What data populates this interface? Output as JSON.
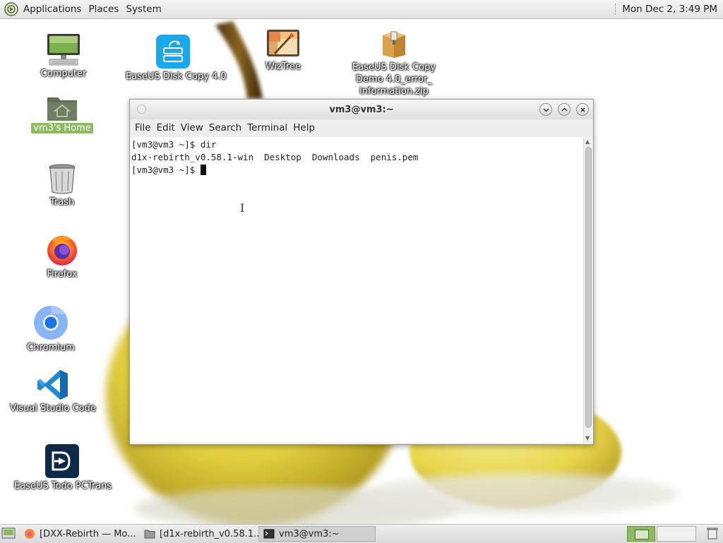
{
  "top_panel": {
    "menus": [
      "Applications",
      "Places",
      "System"
    ],
    "clock": "Mon Dec 2,  3:49 PM"
  },
  "desktop": {
    "icons": [
      {
        "label": "Computer",
        "icon": "computer-icon"
      },
      {
        "label": "vm3's Home",
        "icon": "home-folder-icon",
        "selected": true
      },
      {
        "label": "Trash",
        "icon": "trash-icon"
      },
      {
        "label": "Firefox",
        "icon": "firefox-icon"
      },
      {
        "label": "Chromium",
        "icon": "chromium-icon"
      },
      {
        "label": "Visual Studio Code",
        "icon": "vscode-icon"
      },
      {
        "label": "EaseUS Todo PCTrans",
        "icon": "easeus-pctrans-icon"
      },
      {
        "label": "EaseUS Disk Copy 4.0",
        "icon": "easeus-diskcopy-icon"
      },
      {
        "label": "WizTree",
        "icon": "wiztree-icon"
      },
      {
        "label_lines": [
          "EaseUS Disk Copy",
          "Demo 4.0_error_",
          "information.zip"
        ],
        "icon": "zip-archive-icon"
      }
    ]
  },
  "terminal": {
    "title": "vm3@vm3:~",
    "menus": [
      "File",
      "Edit",
      "View",
      "Search",
      "Terminal",
      "Help"
    ],
    "lines": [
      "[vm3@vm3 ~]$ dir",
      "d1x-rebirth_v0.58.1-win  Desktop  Downloads  penis.pem",
      "[vm3@vm3 ~]$ "
    ]
  },
  "taskbar": {
    "tasks": [
      {
        "label": "[DXX-Rebirth — Mo...",
        "icon": "firefox-icon",
        "active": false
      },
      {
        "label": "[d1x-rebirth_v0.58.1...",
        "icon": "folder-icon",
        "active": false
      },
      {
        "label": "vm3@vm3:~",
        "icon": "terminal-icon",
        "active": true
      }
    ]
  },
  "colors": {
    "selection_green": "#8dbb62",
    "panel_bg": "#e6e6e6",
    "terminal_bg": "#ffffff"
  }
}
